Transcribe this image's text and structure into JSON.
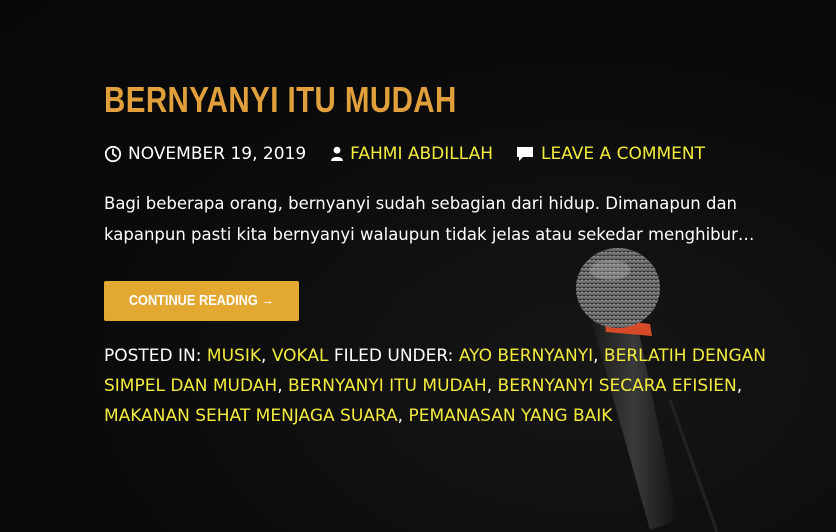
{
  "post": {
    "title": "BERNYANYI ITU MUDAH",
    "date": "NOVEMBER 19, 2019",
    "author": "FAHMI ABDILLAH",
    "comment_link": "LEAVE A COMMENT",
    "excerpt": "Bagi beberapa orang, bernyanyi sudah sebagian dari hidup. Dimanapun dan kapanpun pasti kita bernyanyi walaupun tidak jelas atau sekedar menghibur…",
    "read_more": "CONTINUE READING →",
    "posted_in_label": "POSTED IN:",
    "categories": [
      "MUSIK",
      "VOKAL"
    ],
    "filed_under_label": "FILED UNDER:",
    "tags": [
      "AYO BERNYANYI",
      "BERLATIH DENGAN SIMPEL DAN MUDAH",
      "BERNYANYI ITU MUDAH",
      "BERNYANYI SECARA EFISIEN",
      "MAKANAN SEHAT MENJAGA SUARA",
      "PEMANASAN YANG BAIK"
    ],
    "separator": ", "
  },
  "icons": {
    "date": "clock-icon",
    "author": "user-icon",
    "comments": "comment-icon"
  },
  "colors": {
    "title": "#e2a03c",
    "link": "#f3ec3c",
    "button": "#e2a832",
    "background": "#0a0a0a"
  }
}
